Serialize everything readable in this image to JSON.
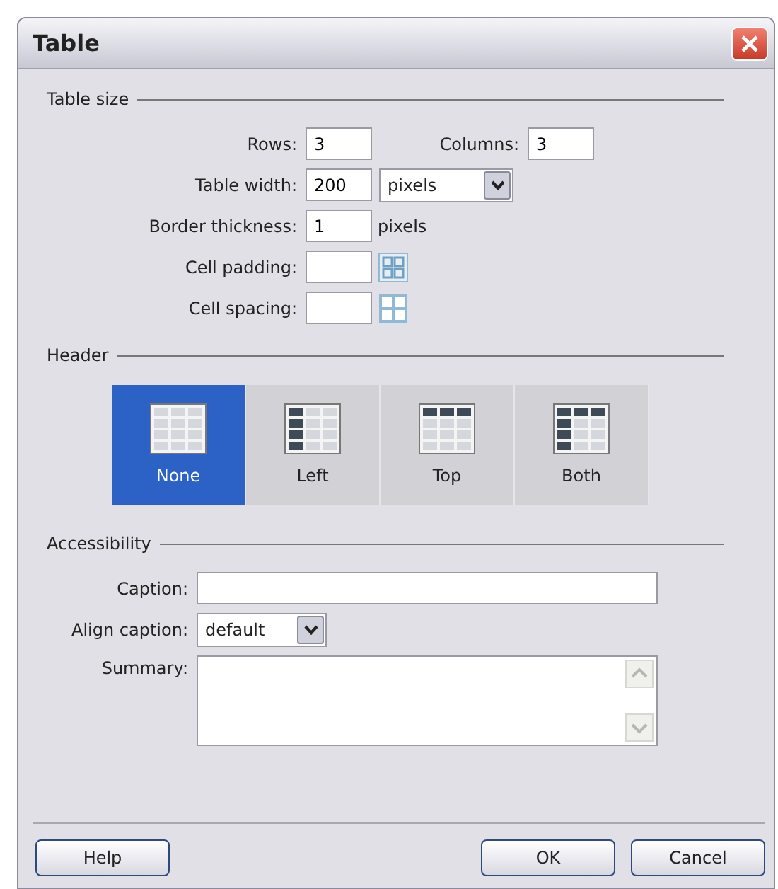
{
  "window": {
    "title": "Table"
  },
  "table_size": {
    "title": "Table size",
    "rows": {
      "label": "Rows:",
      "value": "3"
    },
    "columns": {
      "label": "Columns:",
      "value": "3"
    },
    "table_width": {
      "label": "Table width:",
      "value": "200",
      "unit": "pixels"
    },
    "border_thickness": {
      "label": "Border thickness:",
      "value": "1",
      "unit": "pixels"
    },
    "cell_padding": {
      "label": "Cell padding:"
    },
    "cell_spacing": {
      "label": "Cell spacing:"
    }
  },
  "header": {
    "title": "Header",
    "options": [
      {
        "label": "None",
        "kind": "none",
        "selected": true
      },
      {
        "label": "Left",
        "kind": "left",
        "selected": false
      },
      {
        "label": "Top",
        "kind": "top",
        "selected": false
      },
      {
        "label": "Both",
        "kind": "both",
        "selected": false
      }
    ]
  },
  "accessibility": {
    "title": "Accessibility",
    "caption": {
      "label": "Caption:"
    },
    "align_caption": {
      "label": "Align caption:",
      "value": "default"
    },
    "summary": {
      "label": "Summary:"
    }
  },
  "buttons": [
    "Help",
    "OK",
    "Cancel"
  ]
}
